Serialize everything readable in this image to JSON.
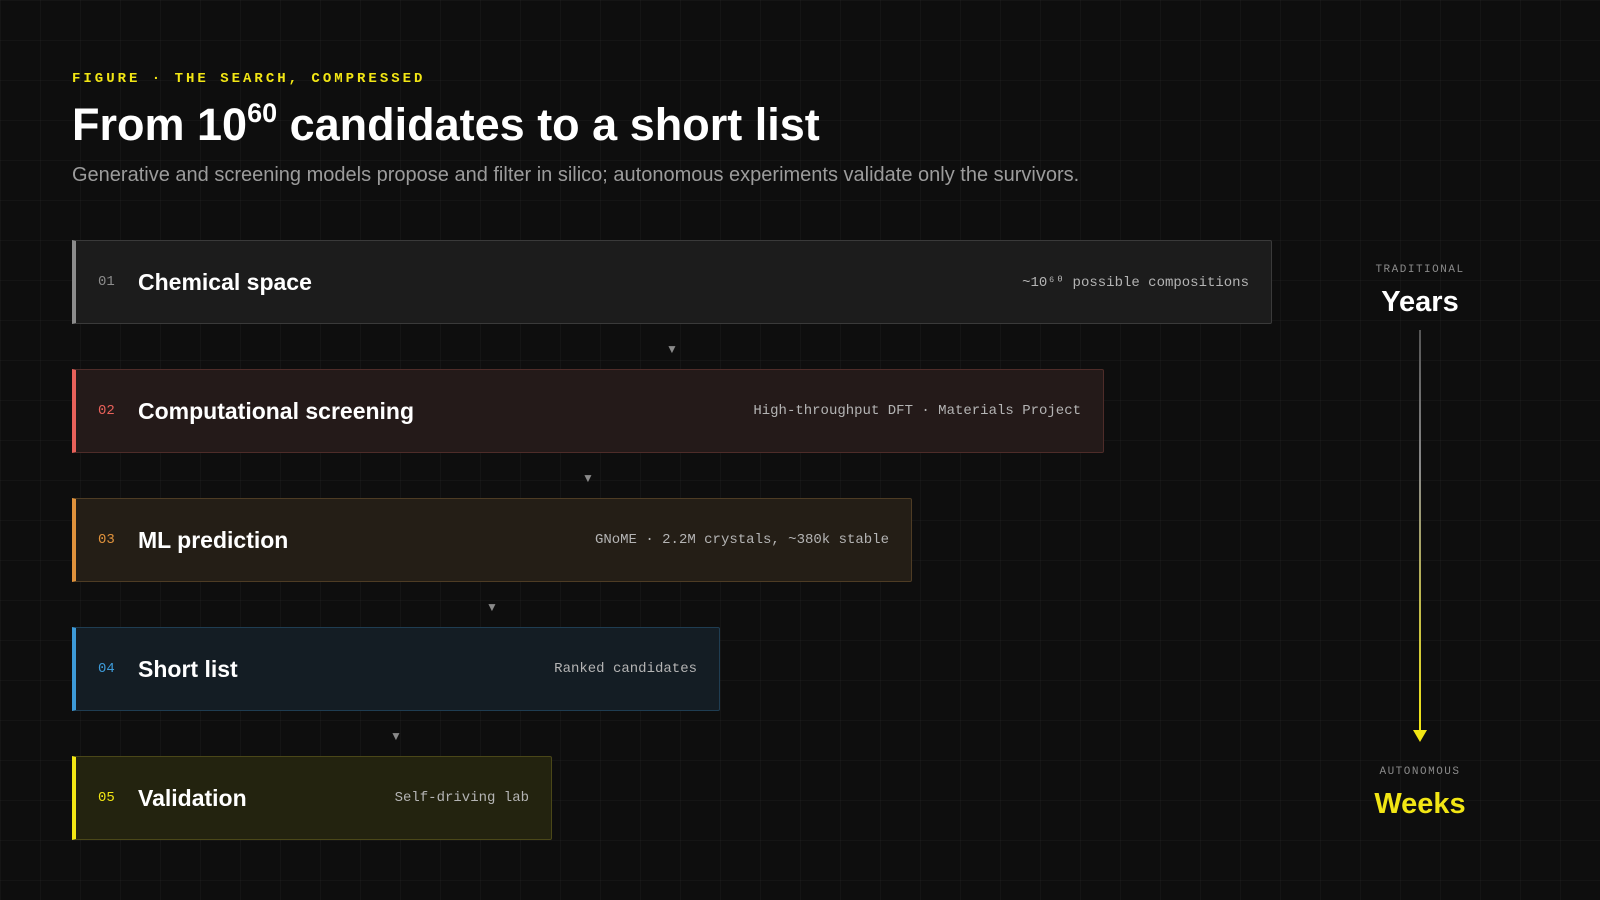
{
  "header": {
    "eyebrow": "FIGURE · THE SEARCH, COMPRESSED",
    "title_prefix": "From 10",
    "title_exponent": "60",
    "title_suffix": " candidates to a short list",
    "subtitle": "Generative and screening models propose and filter in silico; autonomous experiments validate only the survivors."
  },
  "colors": {
    "accent": "#f2e614",
    "stage_01": "#8c8c8c",
    "stage_02": "#e8615a",
    "stage_03": "#e0923c",
    "stage_04": "#3d9ad8",
    "stage_05": "#f2e614"
  },
  "stages": [
    {
      "num": "01",
      "title": "Chemical space",
      "note": "~10⁶⁰ possible compositions"
    },
    {
      "num": "02",
      "title": "Computational screening",
      "note": "High-throughput DFT · Materials Project"
    },
    {
      "num": "03",
      "title": "ML prediction",
      "note": "GNoME · 2.2M crystals, ~380k stable"
    },
    {
      "num": "04",
      "title": "Short list",
      "note": "Ranked candidates"
    },
    {
      "num": "05",
      "title": "Validation",
      "note": "Self-driving lab"
    }
  ],
  "connector_icon": "down-triangle-icon",
  "connector_glyph": "▼",
  "timeline": {
    "top_label": "TRADITIONAL",
    "top_value": "Years",
    "bottom_label": "AUTONOMOUS",
    "bottom_value": "Weeks"
  }
}
